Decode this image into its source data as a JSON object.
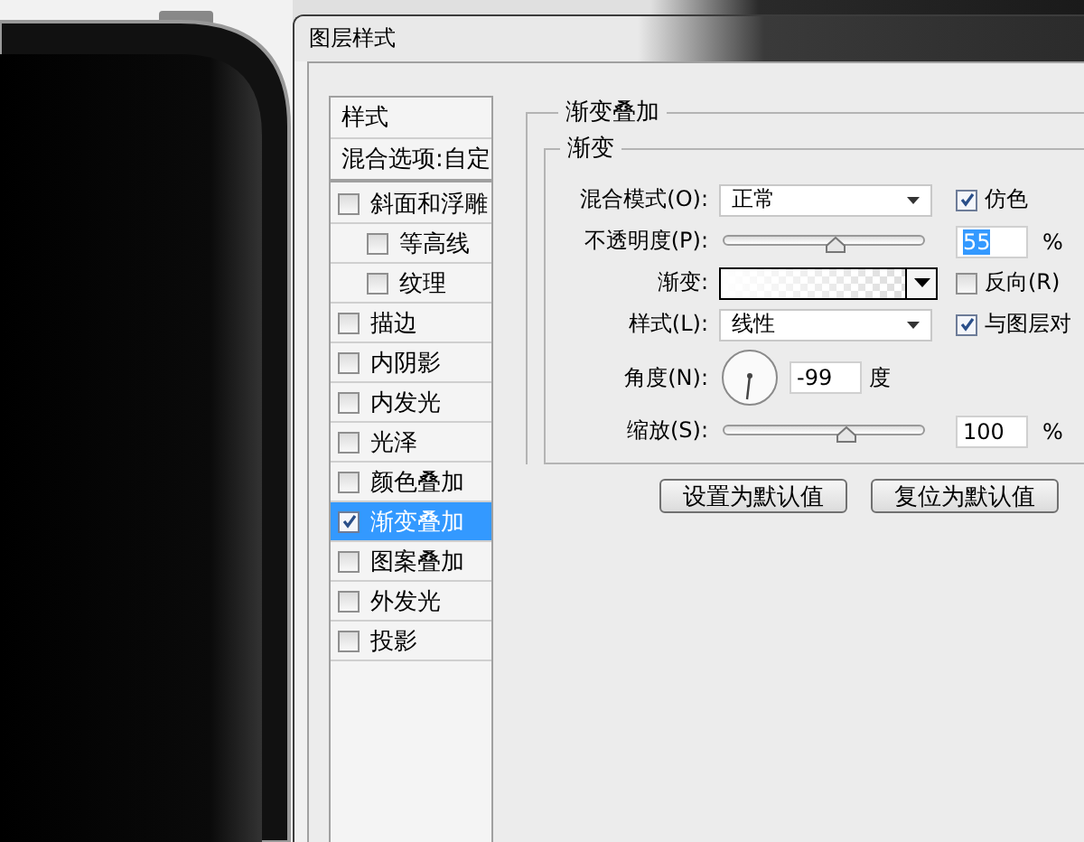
{
  "window": {
    "title": "图层样式"
  },
  "sidebar": {
    "items": [
      {
        "kind": "header",
        "label": "样式",
        "selected": false
      },
      {
        "kind": "header",
        "label": "混合选项:自定",
        "selected": false
      },
      {
        "kind": "effect",
        "label": "斜面和浮雕",
        "checked": false,
        "selected": false,
        "children": [
          {
            "kind": "effect",
            "label": "等高线",
            "checked": false,
            "selected": false
          },
          {
            "kind": "effect",
            "label": "纹理",
            "checked": false,
            "selected": false
          }
        ]
      },
      {
        "kind": "effect",
        "label": "描边",
        "checked": false,
        "selected": false
      },
      {
        "kind": "effect",
        "label": "内阴影",
        "checked": false,
        "selected": false
      },
      {
        "kind": "effect",
        "label": "内发光",
        "checked": false,
        "selected": false
      },
      {
        "kind": "effect",
        "label": "光泽",
        "checked": false,
        "selected": false
      },
      {
        "kind": "effect",
        "label": "颜色叠加",
        "checked": false,
        "selected": false
      },
      {
        "kind": "effect",
        "label": "渐变叠加",
        "checked": true,
        "selected": true
      },
      {
        "kind": "effect",
        "label": "图案叠加",
        "checked": false,
        "selected": false
      },
      {
        "kind": "effect",
        "label": "外发光",
        "checked": false,
        "selected": false
      },
      {
        "kind": "effect",
        "label": "投影",
        "checked": false,
        "selected": false
      }
    ]
  },
  "panel": {
    "title": "渐变叠加",
    "group": {
      "title": "渐变",
      "rows": [
        {
          "kind": "select",
          "label": "混合模式(O):",
          "value": "正常",
          "checkbox": {
            "label": "仿色",
            "checked": true
          }
        },
        {
          "kind": "slider",
          "label": "不透明度(P):",
          "level": 0.55,
          "value": "55",
          "unit": "%",
          "value_selected": true
        },
        {
          "kind": "gradient",
          "label": "渐变:",
          "checkbox": {
            "label": "反向(R)",
            "checked": false
          }
        },
        {
          "kind": "select",
          "label": "样式(L):",
          "value": "线性",
          "checkbox": {
            "label": "与图层对",
            "checked": true
          }
        },
        {
          "kind": "angle",
          "label": "角度(N):",
          "value": "-99",
          "unit": "度"
        },
        {
          "kind": "slider",
          "label": "缩放(S):",
          "level": 0.61,
          "value": "100",
          "unit": "%",
          "value_selected": false
        }
      ]
    }
  },
  "buttons": [
    "设置为默认值",
    "复位为默认值"
  ]
}
